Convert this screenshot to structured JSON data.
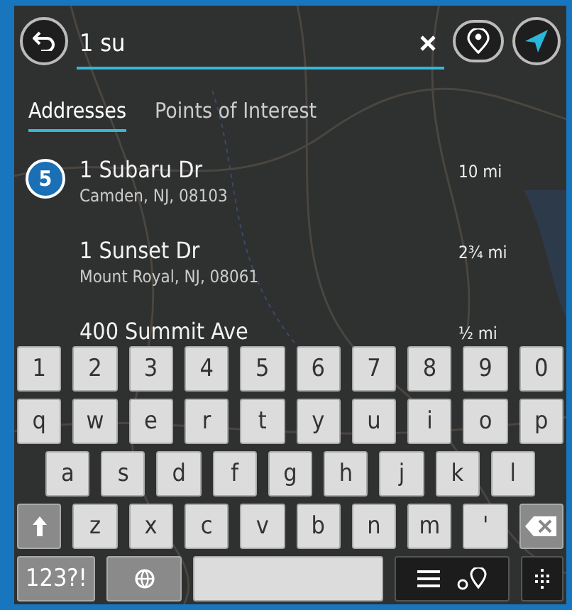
{
  "search": {
    "value": "1 su"
  },
  "tabs": [
    {
      "label": "Addresses",
      "selected": true
    },
    {
      "label": "Points of Interest",
      "selected": false
    }
  ],
  "results": [
    {
      "badge": "5",
      "title": "1 Subaru Dr",
      "subtitle": "Camden, NJ, 08103",
      "distance": "10 mi"
    },
    {
      "title": "1 Sunset Dr",
      "subtitle": "Mount Royal, NJ, 08061",
      "distance": "2¾ mi"
    },
    {
      "title": "400 Summit Ave",
      "distance": "½ mi"
    }
  ],
  "keyboard": [
    [
      {
        "kind": "char",
        "label": "1"
      },
      {
        "kind": "char",
        "label": "2"
      },
      {
        "kind": "char",
        "label": "3"
      },
      {
        "kind": "char",
        "label": "4"
      },
      {
        "kind": "char",
        "label": "5"
      },
      {
        "kind": "char",
        "label": "6"
      },
      {
        "kind": "char",
        "label": "7"
      },
      {
        "kind": "char",
        "label": "8"
      },
      {
        "kind": "char",
        "label": "9"
      },
      {
        "kind": "char",
        "label": "0"
      }
    ],
    [
      {
        "kind": "char",
        "label": "q"
      },
      {
        "kind": "char",
        "label": "w"
      },
      {
        "kind": "char",
        "label": "e"
      },
      {
        "kind": "char",
        "label": "r"
      },
      {
        "kind": "char",
        "label": "t"
      },
      {
        "kind": "char",
        "label": "y"
      },
      {
        "kind": "char",
        "label": "u"
      },
      {
        "kind": "char",
        "label": "i"
      },
      {
        "kind": "char",
        "label": "o"
      },
      {
        "kind": "char",
        "label": "p"
      }
    ],
    [
      {
        "kind": "char",
        "label": "a"
      },
      {
        "kind": "char",
        "label": "s"
      },
      {
        "kind": "char",
        "label": "d"
      },
      {
        "kind": "char",
        "label": "f"
      },
      {
        "kind": "char",
        "label": "g"
      },
      {
        "kind": "char",
        "label": "h"
      },
      {
        "kind": "char",
        "label": "j"
      },
      {
        "kind": "char",
        "label": "k"
      },
      {
        "kind": "char",
        "label": "l"
      }
    ],
    [
      {
        "kind": "shift"
      },
      {
        "kind": "char",
        "label": "z"
      },
      {
        "kind": "char",
        "label": "x"
      },
      {
        "kind": "char",
        "label": "c"
      },
      {
        "kind": "char",
        "label": "v"
      },
      {
        "kind": "char",
        "label": "b"
      },
      {
        "kind": "char",
        "label": "n"
      },
      {
        "kind": "char",
        "label": "m"
      },
      {
        "kind": "char",
        "label": "'"
      },
      {
        "kind": "backspace"
      }
    ],
    [
      {
        "kind": "mode",
        "label": "123?!"
      },
      {
        "kind": "globe"
      },
      {
        "kind": "space"
      },
      {
        "kind": "view"
      },
      {
        "kind": "hide"
      }
    ]
  ]
}
